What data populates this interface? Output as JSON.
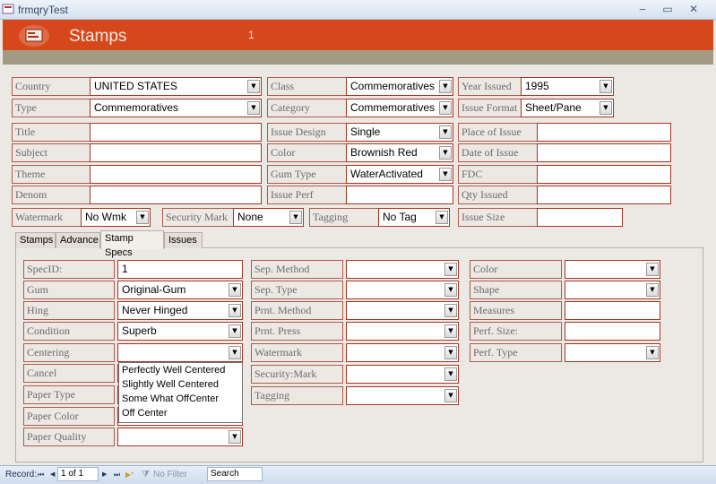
{
  "window": {
    "title": "frmqryTest"
  },
  "header": {
    "title": "Stamps",
    "record_number": "1"
  },
  "top": {
    "country": {
      "label": "Country",
      "value": "UNITED STATES"
    },
    "class": {
      "label": "Class",
      "value": "Commemoratives"
    },
    "year_issued": {
      "label": "Year Issued",
      "value": "1995"
    },
    "type": {
      "label": "Type",
      "value": "Commemoratives"
    },
    "category": {
      "label": "Category",
      "value": "Commemoratives"
    },
    "issue_format": {
      "label": "Issue Format",
      "value": "Sheet/Pane"
    },
    "title": {
      "label": "Title",
      "value": ""
    },
    "issue_design": {
      "label": "Issue Design",
      "value": "Single"
    },
    "place_of_issue": {
      "label": "Place of Issue",
      "value": ""
    },
    "subject": {
      "label": "Subject",
      "value": ""
    },
    "color": {
      "label": "Color",
      "value": "Brownish Red"
    },
    "date_of_issue": {
      "label": "Date of Issue",
      "value": ""
    },
    "theme": {
      "label": "Theme",
      "value": ""
    },
    "gum_type": {
      "label": "Gum Type",
      "value": "WaterActivated"
    },
    "fdc": {
      "label": "FDC",
      "value": ""
    },
    "denom": {
      "label": "Denom",
      "value": ""
    },
    "issue_perf": {
      "label": "Issue Perf",
      "value": ""
    },
    "qty_issued": {
      "label": "Qty Issued",
      "value": ""
    },
    "watermark": {
      "label": "Watermark",
      "value": "No Wmk"
    },
    "security_mark": {
      "label": "Security Mark",
      "value": "None"
    },
    "tagging": {
      "label": "Tagging",
      "value": "No Tag"
    },
    "issue_size": {
      "label": "Issue Size",
      "value": ""
    }
  },
  "tabs": [
    {
      "label": "Stamps",
      "active": false
    },
    {
      "label": "Advance",
      "active": false
    },
    {
      "label": "Stamp Specs",
      "active": true
    },
    {
      "label": "Issues",
      "active": false
    }
  ],
  "specs": {
    "spec_id": {
      "label": "SpecID:",
      "value": "1"
    },
    "gum": {
      "label": "Gum",
      "value": "Original-Gum"
    },
    "hing": {
      "label": "Hing",
      "value": "Never Hinged"
    },
    "condition": {
      "label": "Condition",
      "value": "Superb"
    },
    "centering": {
      "label": "Centering",
      "value": ""
    },
    "cancel": {
      "label": "Cancel",
      "value": ""
    },
    "paper_type": {
      "label": "Paper Type",
      "value": ""
    },
    "paper_color": {
      "label": "Paper Color",
      "value": ""
    },
    "paper_quality": {
      "label": "Paper Quality",
      "value": ""
    },
    "sep_method": {
      "label": "Sep. Method",
      "value": ""
    },
    "sep_type": {
      "label": "Sep. Type",
      "value": ""
    },
    "prnt_method": {
      "label": "Prnt. Method",
      "value": ""
    },
    "prnt_press": {
      "label": "Prnt. Press",
      "value": ""
    },
    "watermark": {
      "label": "Watermark",
      "value": ""
    },
    "security_mark": {
      "label": "Security:Mark",
      "value": ""
    },
    "tagging": {
      "label": "Tagging",
      "value": ""
    },
    "color": {
      "label": "Color",
      "value": ""
    },
    "shape": {
      "label": "Shape",
      "value": ""
    },
    "measures": {
      "label": "Measures",
      "value": ""
    },
    "perf_size": {
      "label": "Perf. Size:",
      "value": ""
    },
    "perf_type": {
      "label": "Perf. Type",
      "value": ""
    }
  },
  "centering_options": [
    "Perfectly Well Centered",
    "Slightly Well Centered",
    "Some What OffCenter",
    "Off Center"
  ],
  "statusbar": {
    "record_label": "Record:",
    "first": "⏮",
    "prev": "◀",
    "position": "1 of 1",
    "next": "▶",
    "last": "⏭",
    "new": "▶*",
    "filter": "No Filter",
    "search": "Search"
  },
  "colors": {
    "header": "#d6481c",
    "band": "#a29a82",
    "field_border": "#a5341f",
    "label_border": "#b0584d",
    "background": "#ece9e4"
  }
}
